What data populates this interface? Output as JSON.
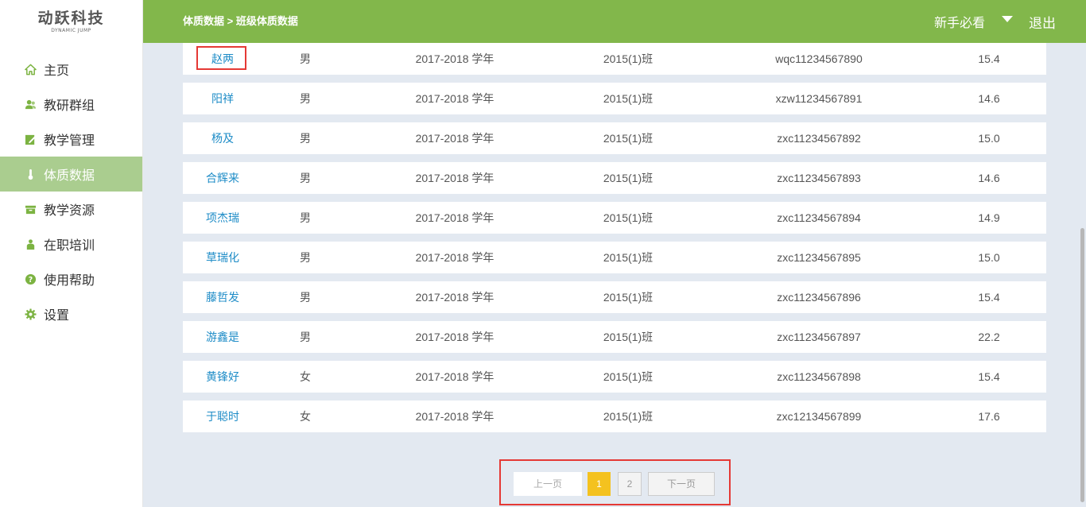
{
  "logo": {
    "main": "动跃科技",
    "sub": "DYNAMIC JUMP"
  },
  "sidebar": {
    "items": [
      {
        "label": "主页",
        "icon": "home-icon",
        "active": false
      },
      {
        "label": "教研群组",
        "icon": "group-icon",
        "active": false
      },
      {
        "label": "教学管理",
        "icon": "edit-icon",
        "active": false
      },
      {
        "label": "体质数据",
        "icon": "thermometer-icon",
        "active": true
      },
      {
        "label": "教学资源",
        "icon": "box-icon",
        "active": false
      },
      {
        "label": "在职培训",
        "icon": "trainer-icon",
        "active": false
      },
      {
        "label": "使用帮助",
        "icon": "help-icon",
        "active": false
      },
      {
        "label": "设置",
        "icon": "gear-icon",
        "active": false
      }
    ]
  },
  "header": {
    "breadcrumb": "体质数据 > 班级体质数据",
    "guide": "新手必看",
    "logout": "退出"
  },
  "colors": {
    "header_bg": "#82b74b",
    "sidebar_active_bg": "#aacd8f",
    "link": "#1e8cc7",
    "page_active": "#f4c21f",
    "highlight_border": "#e53935"
  },
  "table": {
    "rows": [
      {
        "name": "赵两",
        "sex": "男",
        "year": "2017-2018 学年",
        "class": "2015(1)班",
        "id": "wqc11234567890",
        "value": "15.4"
      },
      {
        "name": "阳祥",
        "sex": "男",
        "year": "2017-2018 学年",
        "class": "2015(1)班",
        "id": "xzw11234567891",
        "value": "14.6"
      },
      {
        "name": "杨及",
        "sex": "男",
        "year": "2017-2018 学年",
        "class": "2015(1)班",
        "id": "zxc11234567892",
        "value": "15.0"
      },
      {
        "name": "合辉来",
        "sex": "男",
        "year": "2017-2018 学年",
        "class": "2015(1)班",
        "id": "zxc11234567893",
        "value": "14.6"
      },
      {
        "name": "项杰瑞",
        "sex": "男",
        "year": "2017-2018 学年",
        "class": "2015(1)班",
        "id": "zxc11234567894",
        "value": "14.9"
      },
      {
        "name": "草瑞化",
        "sex": "男",
        "year": "2017-2018 学年",
        "class": "2015(1)班",
        "id": "zxc11234567895",
        "value": "15.0"
      },
      {
        "name": "藤哲发",
        "sex": "男",
        "year": "2017-2018 学年",
        "class": "2015(1)班",
        "id": "zxc11234567896",
        "value": "15.4"
      },
      {
        "name": "游鑫是",
        "sex": "男",
        "year": "2017-2018 学年",
        "class": "2015(1)班",
        "id": "zxc11234567897",
        "value": "22.2"
      },
      {
        "name": "黄锋好",
        "sex": "女",
        "year": "2017-2018 学年",
        "class": "2015(1)班",
        "id": "zxc11234567898",
        "value": "15.4"
      },
      {
        "name": "于聪时",
        "sex": "女",
        "year": "2017-2018 学年",
        "class": "2015(1)班",
        "id": "zxc12134567899",
        "value": "17.6"
      }
    ]
  },
  "pagination": {
    "prev": "上一页",
    "pages": [
      "1",
      "2"
    ],
    "current": "1",
    "next": "下一页"
  }
}
